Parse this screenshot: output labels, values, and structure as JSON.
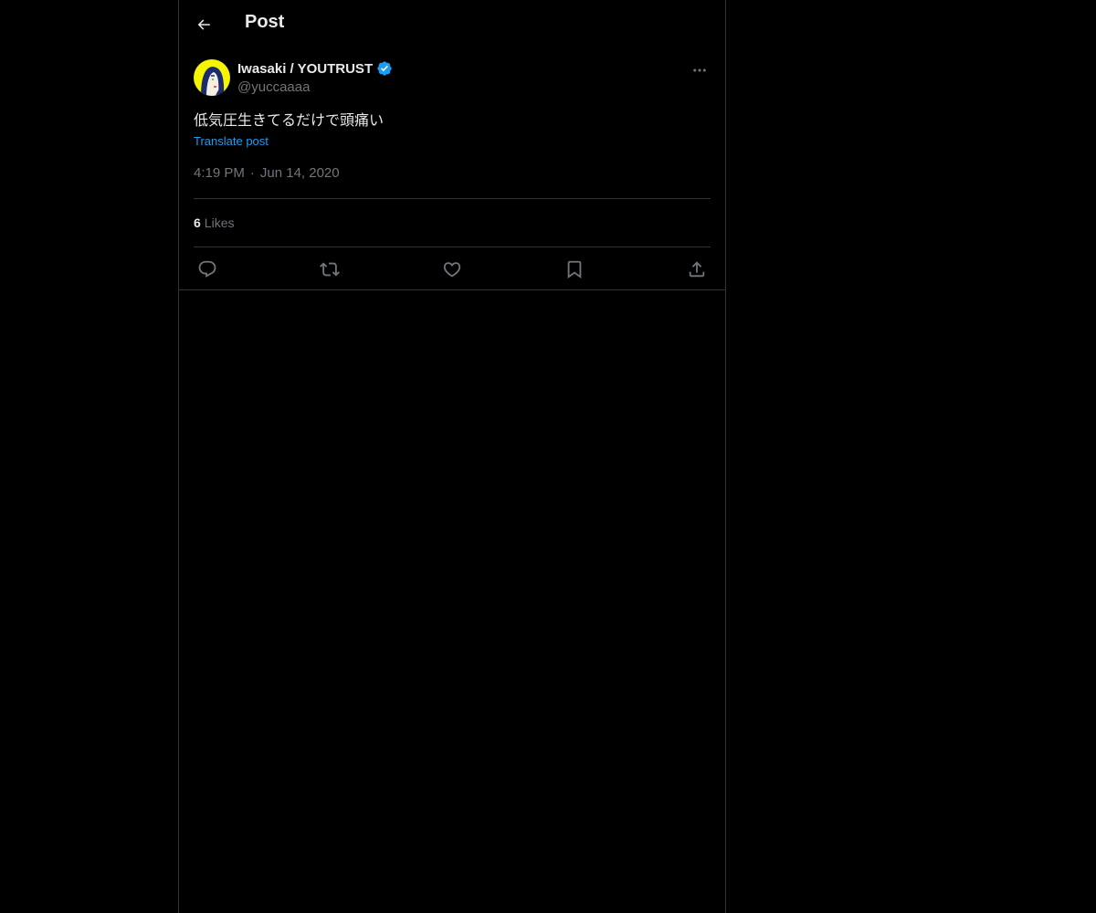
{
  "header": {
    "title": "Post"
  },
  "post": {
    "author": {
      "display_name": "Iwasaki / YOUTRUST",
      "handle": "@yuccaaaa",
      "verified": true
    },
    "text": "低気圧生きてるだけで頭痛い",
    "translate_label": "Translate post",
    "time": "4:19 PM",
    "separator": "·",
    "date": "Jun 14, 2020",
    "likes": {
      "count": "6",
      "label": "Likes"
    }
  },
  "icons": {
    "back": "arrow-left-icon",
    "more": "more-horizontal-icon",
    "verified": "verified-badge-icon",
    "reply": "reply-icon",
    "repost": "repost-icon",
    "like": "heart-icon",
    "bookmark": "bookmark-icon",
    "share": "share-icon"
  },
  "colors": {
    "background": "#000000",
    "text": "#e7e9ea",
    "secondary_text": "#71767b",
    "accent": "#1d9bf0",
    "border": "#2f3336"
  }
}
